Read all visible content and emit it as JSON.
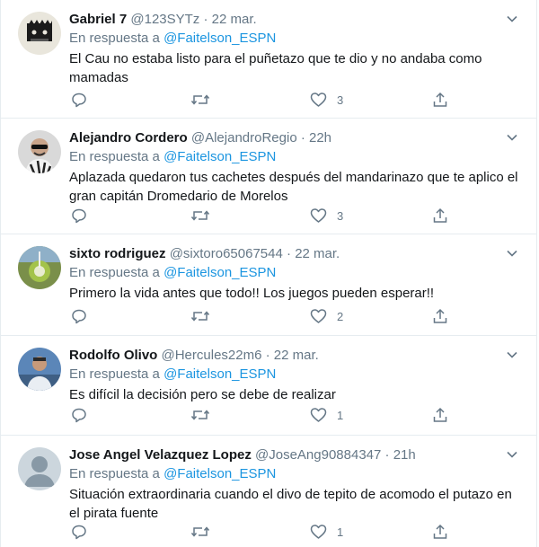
{
  "reply_prefix": "En respuesta a",
  "tweets": [
    {
      "name": "Gabriel 7",
      "handle": "@123SYTz",
      "time": "22 mar.",
      "reply_to": "@Faitelson_ESPN",
      "text": "El Cau no estaba listo para el puñetazo que te dio y no andaba como mamadas",
      "likes": "3"
    },
    {
      "name": "Alejandro Cordero",
      "handle": "@AlejandroRegio",
      "time": "22h",
      "reply_to": "@Faitelson_ESPN",
      "text": "Aplazada quedaron tus cachetes después del mandarinazo que te aplico el gran capitán Dromedario de Morelos",
      "likes": "3"
    },
    {
      "name": "sixto rodriguez",
      "handle": "@sixtoro65067544",
      "time": "22 mar.",
      "reply_to": "@Faitelson_ESPN",
      "text": "Primero la vida antes que todo!! Los juegos pueden esperar!!",
      "likes": "2"
    },
    {
      "name": "Rodolfo Olivo",
      "handle": "@Hercules22m6",
      "time": "22 mar.",
      "reply_to": "@Faitelson_ESPN",
      "text": "Es difícil la decisión pero se debe de realizar",
      "likes": "1"
    },
    {
      "name": "Jose Angel Velazquez Lopez",
      "handle": "@JoseAng90884347",
      "time": "21h",
      "reply_to": "@Faitelson_ESPN",
      "text": "Situación extraordinaria cuando el divo de tepito de acomodo el putazo en el pirata fuente",
      "likes": "1"
    }
  ],
  "colors": {
    "accent": "#1b95e0",
    "muted": "#657786",
    "border": "#e6ecf0"
  }
}
